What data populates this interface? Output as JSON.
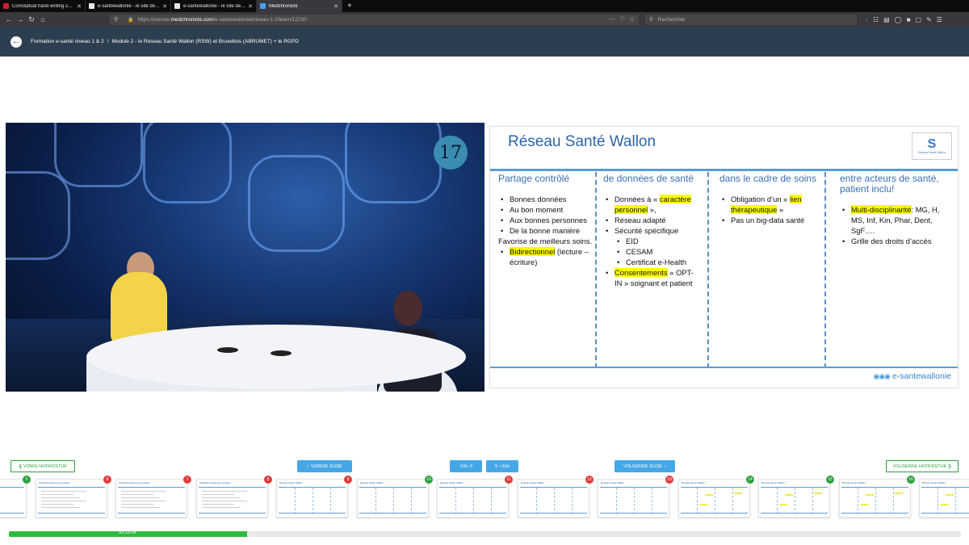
{
  "browser": {
    "tabs": [
      {
        "label": "Conceptual hand writing showi",
        "fav_color": "#d21f2c",
        "active": false
      },
      {
        "label": "e-santewallonie - le site de la forma",
        "fav_color": "#e6e6e6",
        "active": false
      },
      {
        "label": "e-santewallonie - le site de la forma",
        "fav_color": "#e6e6e6",
        "active": false
      },
      {
        "label": "Medchronicle",
        "fav_color": "#45a1ff",
        "active": true
      }
    ],
    "new_tab": "+",
    "url_prefix": "https://course.",
    "url_domain": "medchronicle.com",
    "url_path": "/e-santewallonie/niveau-1-2/learn/12230",
    "search_placeholder": "Rechercher"
  },
  "header": {
    "crumb1": "Formation e-santé niveau 1 & 2",
    "separator": "/",
    "crumb2": "Module 2 - le Réseau Santé Wallon (RSW) et Bruxellois (ABRUMET) + le RGPD"
  },
  "video": {
    "chapter_number": "17"
  },
  "slide": {
    "title": "Réseau Santé Wallon",
    "logo_letter": "S",
    "logo_caption": "Réseau Santé Wallon",
    "footer_logo": "e-santewallonie",
    "columns": [
      {
        "heading": "Partage contrôlé",
        "items": [
          {
            "text": "Bonnes données"
          },
          {
            "text": "Au bon moment"
          },
          {
            "text": "Aux bonnes personnes"
          },
          {
            "text": "De la bonne manière"
          },
          {
            "text": "Favorise de meilleurs soins.",
            "plain": true
          },
          {
            "hl": "Bidirectionnel",
            "text": " (lecture –écriture)"
          }
        ]
      },
      {
        "heading": "de données de santé",
        "items": [
          {
            "text": "Données à « ",
            "hl": "caractère personnel",
            "post": " »,"
          },
          {
            "text": "Réseau adapté"
          },
          {
            "text": "Sécurité spécifique"
          },
          {
            "text": "EID",
            "sub": true
          },
          {
            "text": "CESAM",
            "sub": true
          },
          {
            "text": "Certificat e-Health",
            "sub": true
          },
          {
            "hl": "Consentements",
            "text": " « OPT-IN » soignant et patient"
          }
        ]
      },
      {
        "heading": "dans le cadre de soins",
        "items": [
          {
            "text": "Obligation d’un « ",
            "hl": "lien thérapeutique",
            "post": " »"
          },
          {
            "text": "Pas un big-data santé"
          }
        ]
      },
      {
        "heading": "entre acteurs de santé, patient inclu!",
        "items": [
          {
            "hl": "Multi-disciplinarité",
            "text": ": MG, H, MS, Inf, Kin, Phar, Dent, SgF…."
          },
          {
            "text": "Grille des droits d’accès"
          }
        ]
      }
    ]
  },
  "controls": {
    "prev_chapter": "VORIG HOOFDSTUK",
    "prev_slide": "VORIGE SLIDE",
    "rewind": "-10s",
    "forward": "+10s",
    "next_slide": "VOLGENDE SLIDE",
    "next_chapter": "VOLGENDE HOOFDSTUK",
    "time": "00:15:54",
    "progress_fraction": 0.25
  },
  "thumbnails": [
    {
      "number": "5",
      "status": "green",
      "title": ""
    },
    {
      "number": "6",
      "status": "red",
      "title": "Objectifs réseau des réseaux"
    },
    {
      "number": "7",
      "status": "red",
      "title": "Objectifs réseau des réseaux"
    },
    {
      "number": "8",
      "status": "red",
      "title": "Objectifs réseau des réseaux"
    },
    {
      "number": "9",
      "status": "red",
      "title": "Réseau Santé Wallon"
    },
    {
      "number": "10",
      "status": "green",
      "title": "Réseau Santé Wallon"
    },
    {
      "number": "11",
      "status": "red",
      "title": "Réseau Santé Wallon"
    },
    {
      "number": "12",
      "status": "red",
      "title": "Réseau Santé Wallon"
    },
    {
      "number": "13",
      "status": "red",
      "title": "Réseau Santé Wallon"
    },
    {
      "number": "14",
      "status": "green",
      "title": "Réseau Santé Wallon"
    },
    {
      "number": "15",
      "status": "green",
      "title": "Réseau Santé Wallon"
    },
    {
      "number": "16",
      "status": "green",
      "title": "Réseau Santé Wallon"
    },
    {
      "number": "17",
      "status": "green",
      "title": "Réseau Santé Wallon"
    }
  ],
  "colors": {
    "header_bg": "#2d3e50",
    "accent_green": "#2e9e3e",
    "accent_blue": "#45a7e6",
    "badge_red": "#e03b3b",
    "slide_title": "#2d64a8",
    "highlight": "#ffff00"
  }
}
